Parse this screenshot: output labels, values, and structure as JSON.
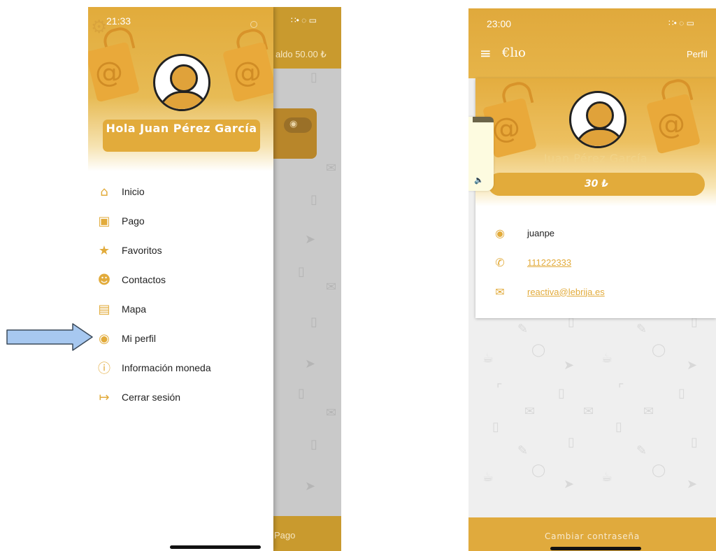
{
  "left_phone": {
    "status_time": "21:33",
    "status_signal": "∷• ◌ ▭",
    "background": {
      "balance_text": "aldo 50.00 ₺",
      "bottom_text": "Pago"
    },
    "drawer": {
      "greeting": "Hola Juan Pérez García",
      "menu": [
        {
          "label": "Inicio",
          "icon": "home-icon",
          "glyph": "⌂"
        },
        {
          "label": "Pago",
          "icon": "cash-icon",
          "glyph": "▣"
        },
        {
          "label": "Favoritos",
          "icon": "star-icon",
          "glyph": "★"
        },
        {
          "label": "Contactos",
          "icon": "contacts-icon",
          "glyph": "☻"
        },
        {
          "label": "Mapa",
          "icon": "map-icon",
          "glyph": "▤"
        },
        {
          "label": "Mi perfil",
          "icon": "user-circle-icon",
          "glyph": "◉"
        },
        {
          "label": "Información moneda",
          "icon": "info-icon",
          "glyph": "ⓘ"
        },
        {
          "label": "Cerrar sesión",
          "icon": "logout-icon",
          "glyph": "↦"
        }
      ]
    }
  },
  "right_phone": {
    "status_time": "23:00",
    "header": {
      "menu_glyph": "≡",
      "logo": "€lıo",
      "right_label": "Perfil"
    },
    "profile": {
      "name": "Juan Pérez García",
      "balance": "30 ₺",
      "username": "juanpe",
      "phone": "111222333",
      "email": "reactiva@lebrija.es"
    },
    "bottom_button": "Cambiar contraseña"
  },
  "colors": {
    "accent": "#e2ab3b",
    "drawer_bg": "#ffffff",
    "overlay": "#c9c9c9",
    "arrow_fill": "#a7c8f0",
    "arrow_stroke": "#3b4a5a"
  }
}
